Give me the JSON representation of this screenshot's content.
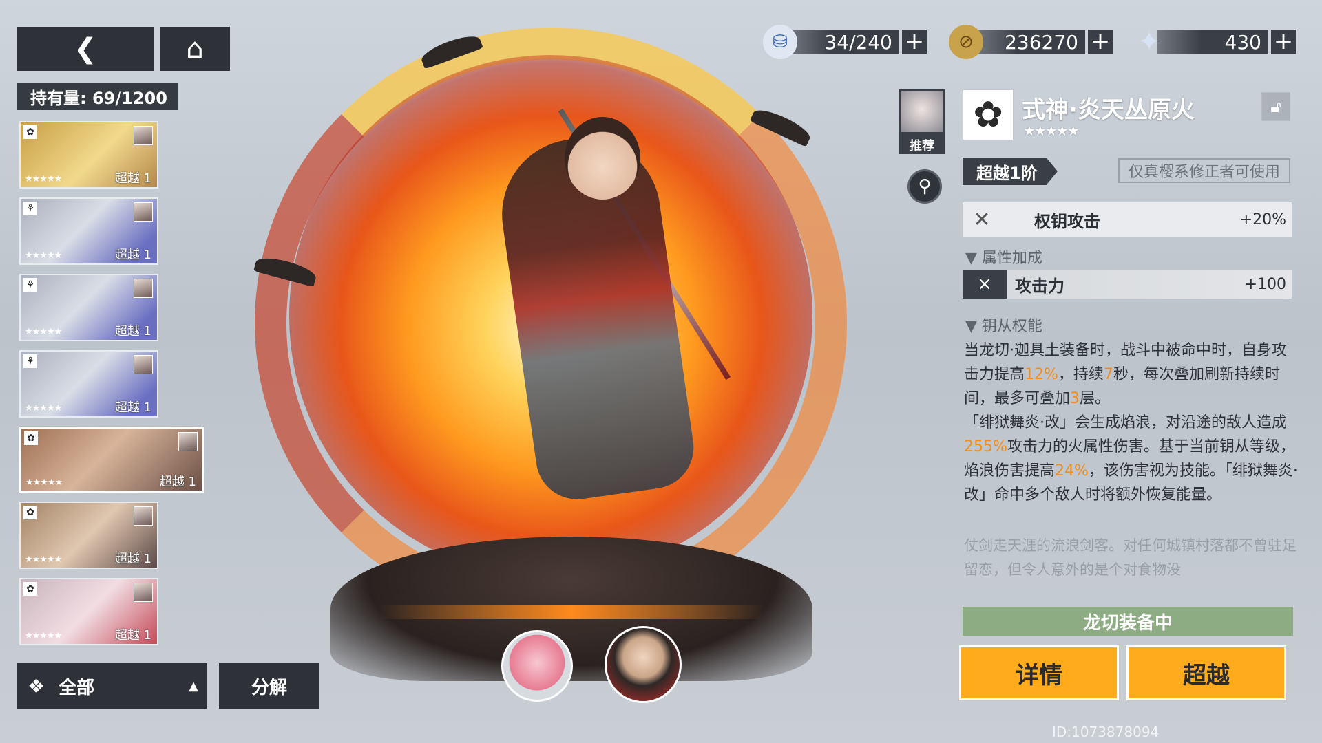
{
  "nav": {
    "back_icon": "chevron-left-icon",
    "home_icon": "home-icon"
  },
  "inventory": {
    "holding_label": "持有量: 69/1200"
  },
  "cards": [
    {
      "style": "gold",
      "tag_icon": "sakura-tag-icon",
      "stars": "★★★★★",
      "transcend": "超越 1"
    },
    {
      "style": "blue",
      "tag_icon": "branch-tag-icon",
      "stars": "★★★★★",
      "transcend": "超越 1"
    },
    {
      "style": "blue",
      "tag_icon": "branch-tag-icon",
      "stars": "★★★★★",
      "transcend": "超越 1"
    },
    {
      "style": "blue",
      "tag_icon": "branch-tag-icon",
      "stars": "★★★★★",
      "transcend": "超越 1"
    },
    {
      "style": "selected",
      "tag_icon": "sakura-tag-icon",
      "stars": "★★★★★",
      "transcend": "超越 1"
    },
    {
      "style": "dark",
      "tag_icon": "sakura-tag-icon",
      "stars": "★★★★★",
      "transcend": "超越 1"
    },
    {
      "style": "pink",
      "tag_icon": "sakura-tag-icon",
      "stars": "★★★★★",
      "transcend": "超越 1"
    }
  ],
  "filter": {
    "label": "全部",
    "decompose_label": "分解"
  },
  "currencies": [
    {
      "icon": "stamina-icon",
      "value": "34/240"
    },
    {
      "icon": "coin-icon",
      "value": "236270"
    },
    {
      "icon": "crystal-icon",
      "value": "430"
    }
  ],
  "recommend": {
    "label": "推荐"
  },
  "equipment": {
    "name": "式神·炎天丛原火",
    "stars": "★★★★★",
    "tier": "超越1阶",
    "restriction": "仅真樱系修正者可使用",
    "main_stat": {
      "name": "权钥攻击",
      "value": "+20%"
    },
    "attr_header": "属性加成",
    "sub_stat": {
      "name": "攻击力",
      "value": "+100"
    },
    "skill_header": "钥从权能",
    "desc": {
      "p1a": "当龙切·迦具土装备时，战斗中被命中时，自身攻击力提高",
      "h1": "12%",
      "p1b": "，持续",
      "h2": "7",
      "p1c": "秒，每次叠加刷新持续时间，最多可叠加",
      "h3": "3",
      "p1d": "层。",
      "p2a": "「绯狱舞炎·改」会生成焰浪，对沿途的敌人造成",
      "h4": "255%",
      "p2b": "攻击力的火属性伤害。基于当前钥从等级，焰浪伤害提高",
      "h5": "24%",
      "p2c": "，该伤害视为技能。「绯狱舞炎·改」命中多个敌人时将额外恢复能量。"
    },
    "flavor": "仗剑走天涯的流浪剑客。对任何城镇村落都不曾驻足留恋，但令人意外的是个对食物没",
    "equipped_status": "龙切装备中",
    "detail_label": "详情",
    "transcend_label": "超越"
  },
  "user_id": "ID:1073878094",
  "colors": {
    "accent": "#ffab1c",
    "highlight": "#f28c1a",
    "equipped": "#8eac84",
    "dark_panel": "#2e3238"
  }
}
